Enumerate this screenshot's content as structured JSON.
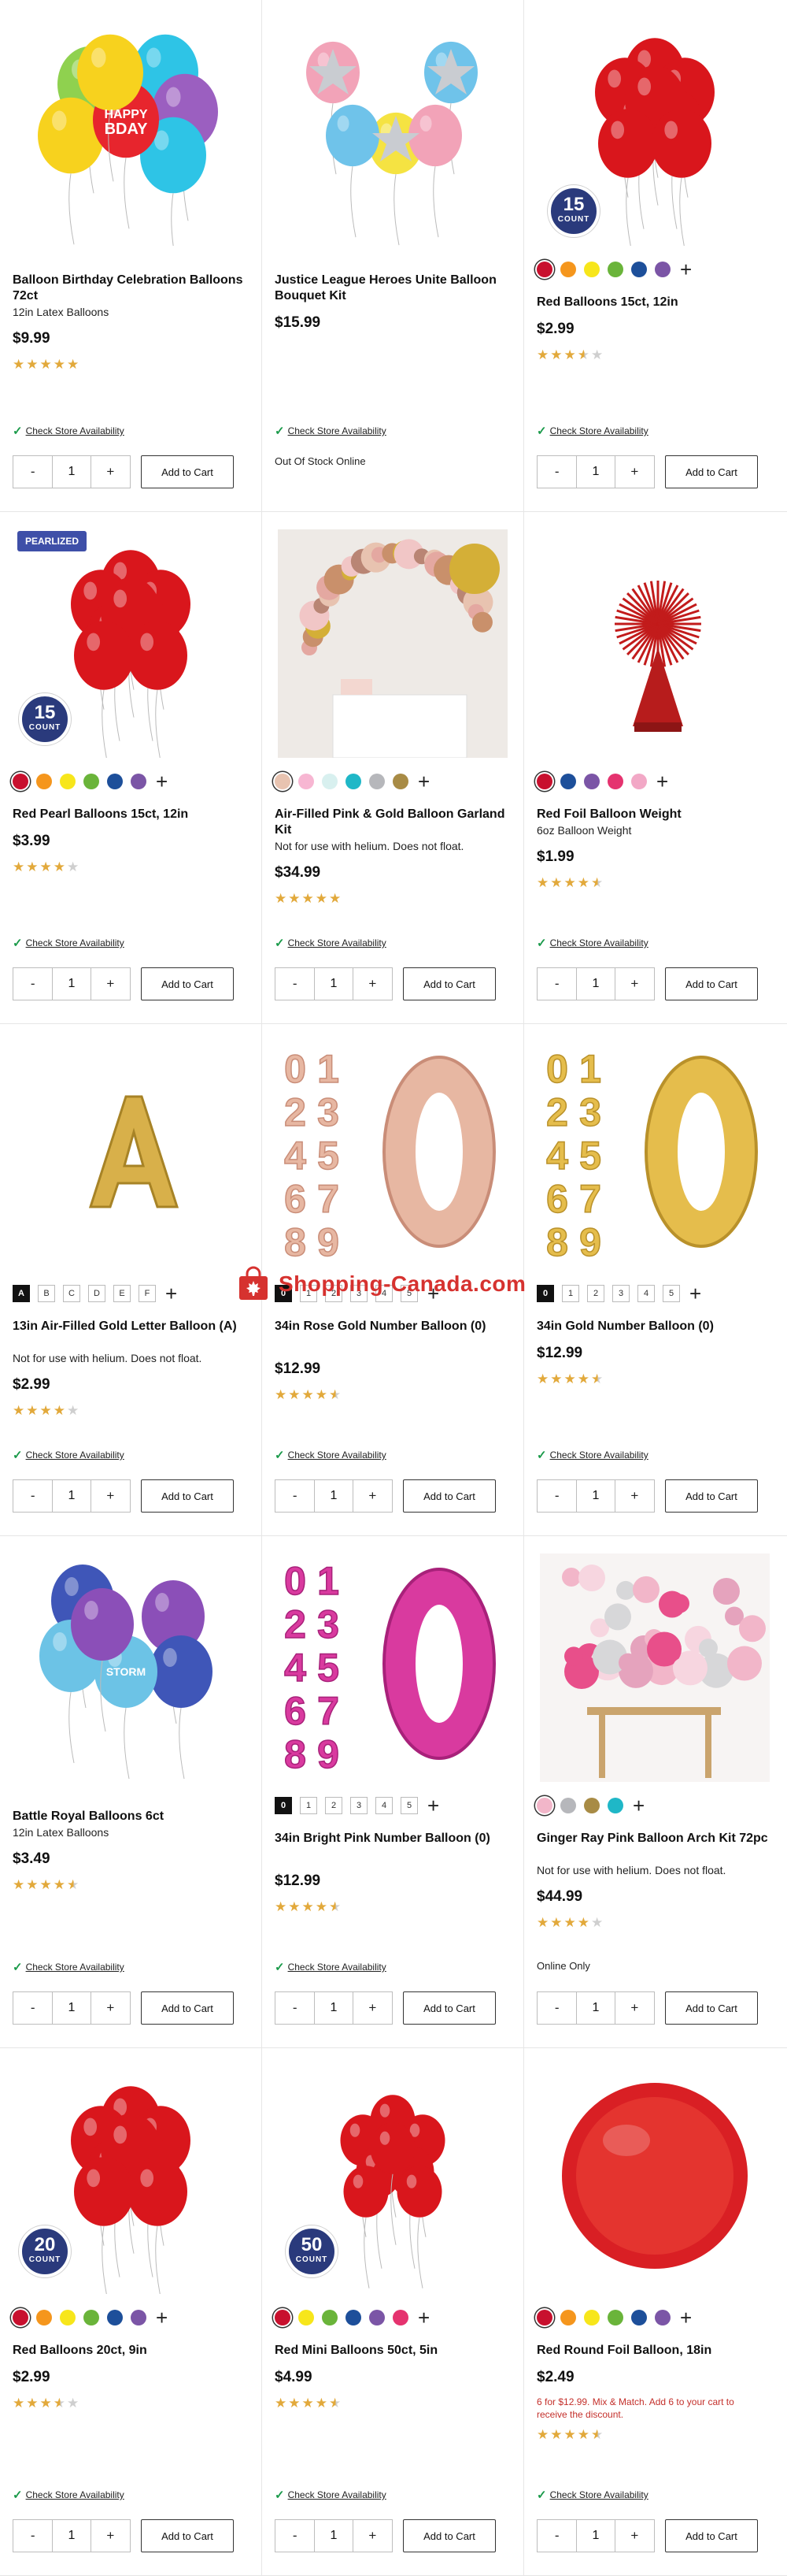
{
  "colors": {
    "star": "#e2a93b",
    "check": "#1a9a4a",
    "promo": "#c4302b",
    "badge": "#2a3a7c"
  },
  "products": [
    {
      "title": "Balloon Birthday Celebration Balloons 72ct",
      "subtitle": "12in Latex Balloons",
      "price": "$9.99",
      "rating": 5,
      "availability": "Check Store Availability",
      "qty": "1",
      "minus": "-",
      "plus": "+",
      "cta": "Add to Cart"
    },
    {
      "title": "Justice League Heroes Unite Balloon Bouquet Kit",
      "price": "$15.99",
      "availability": "Check Store Availability",
      "note": "Out Of Stock Online",
      "qty": "1",
      "minus": "-",
      "plus": "+",
      "cta": "Add to Cart"
    },
    {
      "title": "Red Balloons 15ct, 12in",
      "price": "$2.99",
      "rating": 3.5,
      "badge": {
        "count": "15",
        "label": "COUNT"
      },
      "swatches": [
        "#c8102e",
        "#f5961d",
        "#f7e61b",
        "#6ab43a",
        "#1d4f9a",
        "#7b55a6"
      ],
      "availability": "Check Store Availability",
      "qty": "1",
      "minus": "-",
      "plus": "+",
      "cta": "Add to Cart"
    },
    {
      "title": "Red Pearl Balloons 15ct, 12in",
      "price": "$3.99",
      "rating": 4,
      "ribbon": "PEARLIZED",
      "badge": {
        "count": "15",
        "label": "COUNT"
      },
      "swatches": [
        "#c8102e",
        "#f5961d",
        "#f7e61b",
        "#6ab43a",
        "#1d4f9a",
        "#7b55a6"
      ],
      "availability": "Check Store Availability",
      "qty": "1",
      "minus": "-",
      "plus": "+",
      "cta": "Add to Cart"
    },
    {
      "title": "Air-Filled Pink & Gold Balloon Garland Kit",
      "subtitle": "Not for use with helium. Does not float.",
      "price": "$34.99",
      "rating": 5,
      "swatches": [
        "#e8c3b0",
        "#f7b6d2",
        "#d8f0ef",
        "#1fb7c7",
        "#b6b7bb",
        "#a88b45"
      ],
      "availability": "Check Store Availability",
      "qty": "1",
      "minus": "-",
      "plus": "+",
      "cta": "Add to Cart"
    },
    {
      "title": "Red Foil Balloon Weight",
      "subtitle": "6oz Balloon Weight",
      "price": "$1.99",
      "rating": 4.5,
      "swatches": [
        "#c8102e",
        "#1d4f9a",
        "#7b55a6",
        "#e5336f",
        "#f2a8c6"
      ],
      "availability": "Check Store Availability",
      "qty": "1",
      "minus": "-",
      "plus": "+",
      "cta": "Add to Cart"
    },
    {
      "title": "13in Air-Filled Gold Letter Balloon (A)",
      "subtitle": "Not for use with helium. Does not float.",
      "price": "$2.99",
      "rating": 4,
      "letters": [
        "A",
        "B",
        "C",
        "D",
        "E",
        "F"
      ],
      "availability": "Check Store Availability",
      "qty": "1",
      "minus": "-",
      "plus": "+",
      "cta": "Add to Cart"
    },
    {
      "title": "34in Rose Gold Number Balloon (0)",
      "price": "$12.99",
      "rating": 4.5,
      "letters": [
        "0",
        "1",
        "2",
        "3",
        "4",
        "5"
      ],
      "availability": "Check Store Availability",
      "qty": "1",
      "minus": "-",
      "plus": "+",
      "cta": "Add to Cart"
    },
    {
      "title": "34in Gold Number Balloon (0)",
      "price": "$12.99",
      "rating": 4.5,
      "letters": [
        "0",
        "1",
        "2",
        "3",
        "4",
        "5"
      ],
      "availability": "Check Store Availability",
      "qty": "1",
      "minus": "-",
      "plus": "+",
      "cta": "Add to Cart"
    },
    {
      "title": "Battle Royal Balloons 6ct",
      "subtitle": "12in Latex Balloons",
      "price": "$3.49",
      "rating": 4.5,
      "availability": "Check Store Availability",
      "qty": "1",
      "minus": "-",
      "plus": "+",
      "cta": "Add to Cart"
    },
    {
      "title": "34in Bright Pink Number Balloon (0)",
      "price": "$12.99",
      "rating": 4.5,
      "letters": [
        "0",
        "1",
        "2",
        "3",
        "4",
        "5"
      ],
      "availability": "Check Store Availability",
      "qty": "1",
      "minus": "-",
      "plus": "+",
      "cta": "Add to Cart"
    },
    {
      "title": "Ginger Ray Pink Balloon Arch Kit 72pc",
      "subtitle": "Not for use with helium. Does not float.",
      "price": "$44.99",
      "rating": 4,
      "swatches": [
        "#f2b6c9",
        "#b6b7bb",
        "#a88b45",
        "#1fb7c7"
      ],
      "note": "Online Only",
      "qty": "1",
      "minus": "-",
      "plus": "+",
      "cta": "Add to Cart"
    },
    {
      "title": "Red Balloons 20ct, 9in",
      "price": "$2.99",
      "rating": 3.5,
      "badge": {
        "count": "20",
        "label": "COUNT"
      },
      "swatches": [
        "#c8102e",
        "#f5961d",
        "#f7e61b",
        "#6ab43a",
        "#1d4f9a",
        "#7b55a6"
      ],
      "availability": "Check Store Availability",
      "qty": "1",
      "minus": "-",
      "plus": "+",
      "cta": "Add to Cart"
    },
    {
      "title": "Red Mini Balloons 50ct, 5in",
      "price": "$4.99",
      "rating": 4.5,
      "badge": {
        "count": "50",
        "label": "COUNT"
      },
      "swatches": [
        "#c8102e",
        "#f7e61b",
        "#6ab43a",
        "#1d4f9a",
        "#7b55a6",
        "#e5336f"
      ],
      "availability": "Check Store Availability",
      "qty": "1",
      "minus": "-",
      "plus": "+",
      "cta": "Add to Cart"
    },
    {
      "title": "Red Round Foil Balloon, 18in",
      "price": "$2.49",
      "promo": "6 for $12.99. Mix & Match. Add 6 to your cart to receive the discount.",
      "rating": 4.5,
      "swatches": [
        "#c8102e",
        "#f5961d",
        "#f7e61b",
        "#6ab43a",
        "#1d4f9a",
        "#7b55a6"
      ],
      "availability": "Check Store Availability",
      "qty": "1",
      "minus": "-",
      "plus": "+",
      "cta": "Add to Cart"
    }
  ],
  "watermark": {
    "text": "Shopping-Canada.com"
  }
}
